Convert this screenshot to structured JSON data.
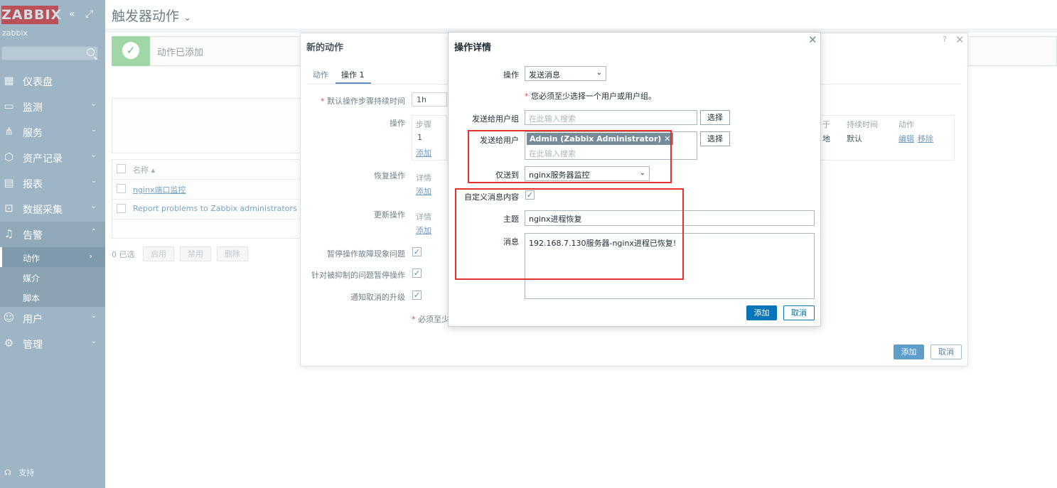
{
  "brand": {
    "logo": "ZABBIX",
    "server": "zabbix",
    "collapse_icon": "«",
    "kiosk_icon": "⤢"
  },
  "sidebar": {
    "items": [
      {
        "label": "仪表盘",
        "icon": "dashboard-icon",
        "glyph": "▦"
      },
      {
        "label": "监测",
        "icon": "monitoring-icon",
        "glyph": "▭",
        "chev": "⌄"
      },
      {
        "label": "服务",
        "icon": "services-icon",
        "glyph": "⋔",
        "chev": "⌄"
      },
      {
        "label": "资产记录",
        "icon": "inventory-icon",
        "glyph": "⬡",
        "chev": "⌄"
      },
      {
        "label": "报表",
        "icon": "reports-icon",
        "glyph": "▤",
        "chev": "⌄"
      },
      {
        "label": "数据采集",
        "icon": "data-collection-icon",
        "glyph": "⊡",
        "chev": "⌄"
      },
      {
        "label": "告警",
        "icon": "alerts-bell-icon",
        "glyph": "♫",
        "chev": "⌃"
      },
      {
        "label": "用户",
        "icon": "users-icon",
        "glyph": "☺",
        "chev": "⌄"
      },
      {
        "label": "管理",
        "icon": "administration-gear-icon",
        "glyph": "⚙",
        "chev": "⌄"
      }
    ],
    "subitems": [
      {
        "label": "动作",
        "chev": "›"
      },
      {
        "label": "媒介"
      },
      {
        "label": "脚本"
      }
    ],
    "support": "支持"
  },
  "main": {
    "title": "触发器动作",
    "title_chev": "⌄",
    "message": "动作已添加",
    "list_header": "名称 ▴",
    "rows": [
      "nginx端口监控",
      "Report problems to Zabbix administrators"
    ],
    "selected": "0 已选",
    "bulk": [
      "启用",
      "禁用",
      "删除"
    ]
  },
  "new_action": {
    "title": "新的动作",
    "tabs": [
      "动作",
      "操作 1"
    ],
    "default_step_label": "默认操作步骤持续时间",
    "default_step_value": "1h",
    "operations_label": "操作",
    "ops_header": "步骤",
    "ops_step": "1",
    "ops_add": "添加",
    "ops_right": {
      "col_a": "于",
      "col_b": "持续时间",
      "col_c": "动作",
      "v_a": "地",
      "v_b": "默认",
      "edit": "编辑",
      "remove": "移除"
    },
    "recovery_label": "恢复操作",
    "recovery_detail": "详情",
    "recovery_add": "添加",
    "update_label": "更新操作",
    "update_detail": "详情",
    "update_add": "添加",
    "pause_label": "暂停操作故障现象问题",
    "suppressed_label": "针对被抑制的问题暂停操作",
    "notify_label": "通知取消的升级",
    "required_note": "必须至少",
    "add": "添加",
    "cancel": "取消"
  },
  "op_details": {
    "title": "操作详情",
    "operation_label": "操作",
    "operation_value": "发送消息",
    "warning": "您必须至少选择一个用户或用户组。",
    "user_groups_label": "发送给用户组",
    "user_groups_placeholder": "在此输入搜索",
    "select": "选择",
    "users_label": "发送给用户",
    "user_tag": "Admin (Zabbix Administrator)",
    "users_placeholder": "在此输入搜索",
    "send_only_label": "仅送到",
    "send_only_value": "nginx服务器监控",
    "custom_msg_label": "自定义消息内容",
    "subject_label": "主题",
    "subject_value": "nginx进程恢复",
    "message_label": "消息",
    "message_value": "192.168.7.130服务器-nginx进程已恢复!",
    "add": "添加",
    "cancel": "取消"
  }
}
